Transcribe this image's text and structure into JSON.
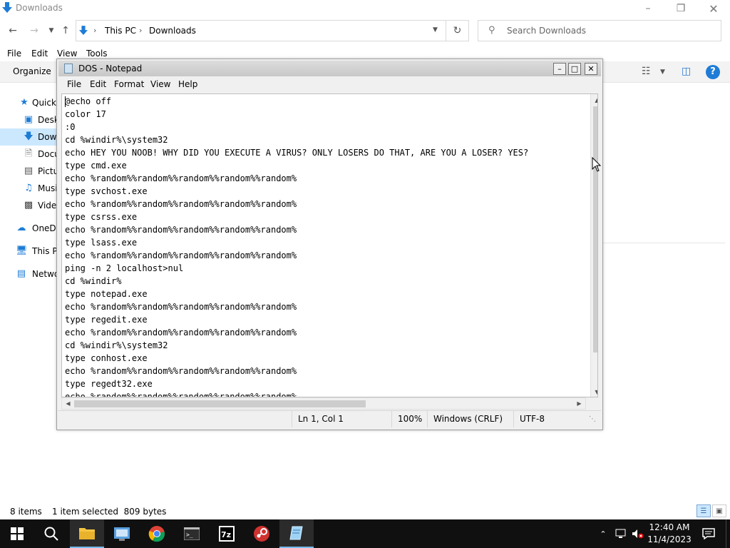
{
  "explorer": {
    "title": "Downloads",
    "address": [
      "This PC",
      "Downloads"
    ],
    "search_placeholder": "Search Downloads",
    "menu": [
      "File",
      "Edit",
      "View",
      "Tools"
    ],
    "organize": "Organize",
    "nav": [
      "Quick",
      "Desk",
      "Dow",
      "Docu",
      "Pictu",
      "Musi",
      "Vide",
      "OneDr",
      "This P",
      "Netwo"
    ],
    "status_items": "8 items",
    "status_selected": "1 item selected  809 bytes"
  },
  "notepad": {
    "title": "DOS - Notepad",
    "menu": [
      "File",
      "Edit",
      "Format",
      "View",
      "Help"
    ],
    "lines": [
      "@echo off",
      "color 17",
      ":0",
      "cd %windir%\\system32",
      "echo HEY YOU NOOB! WHY DID YOU EXECUTE A VIRUS? ONLY LOSERS DO THAT, ARE YOU A LOSER? YES?",
      "type cmd.exe",
      "echo %random%%random%%random%%random%%random%",
      "type svchost.exe",
      "echo %random%%random%%random%%random%%random%",
      "type csrss.exe",
      "echo %random%%random%%random%%random%%random%",
      "type lsass.exe",
      "echo %random%%random%%random%%random%%random%",
      "ping -n 2 localhost>nul",
      "cd %windir%",
      "type notepad.exe",
      "echo %random%%random%%random%%random%%random%",
      "type regedit.exe",
      "echo %random%%random%%random%%random%%random%",
      "cd %windir%\\system32",
      "type conhost.exe",
      "echo %random%%random%%random%%random%%random%",
      "type regedt32.exe",
      "echo %random%%random%%random%%random%%random%"
    ],
    "status": {
      "position": "Ln 1, Col 1",
      "zoom": "100%",
      "line_ending": "Windows (CRLF)",
      "encoding": "UTF-8"
    }
  },
  "taskbar": {
    "time": "12:40 AM",
    "date": "11/4/2023",
    "colors": {
      "bar": "#101010",
      "active_underline": "#76b9ed",
      "accent": "#0078d7"
    }
  }
}
